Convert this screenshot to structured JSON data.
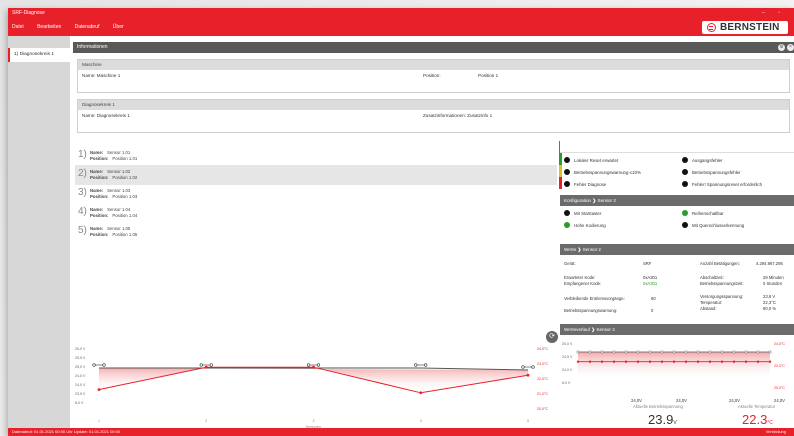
{
  "app": {
    "title": "SRF-Diagnose"
  },
  "menu": {
    "items": [
      "Datei",
      "Bearbeiten",
      "Datenabruf",
      "Über"
    ]
  },
  "logo": {
    "text": "BERNSTEIN"
  },
  "sidebar": {
    "items": [
      {
        "label": "1) Diagnosekreis 1"
      }
    ]
  },
  "info": {
    "header": "Informationen",
    "maschine": {
      "title": "Maschine",
      "name": "Name: Maschine 1",
      "position_label": "Position:",
      "position_value": "Position 1"
    },
    "diagnosekreis": {
      "title": "Diagnosekreis 1",
      "name": "Name: Diagnosekreis 1",
      "zusatz": "Zusatzinformationen: Zusatzinfo 1"
    }
  },
  "sensors": [
    {
      "num": "1)",
      "name_label": "Name:",
      "name": "Sensor 1.01",
      "pos_label": "Position:",
      "position": "Position 1.01"
    },
    {
      "num": "2)",
      "name_label": "Name:",
      "name": "Sensor 1.02",
      "pos_label": "Position:",
      "position": "Position 1.02"
    },
    {
      "num": "3)",
      "name_label": "Name:",
      "name": "Sensor 1.03",
      "pos_label": "Position:",
      "position": "Position 1.03"
    },
    {
      "num": "4)",
      "name_label": "Name:",
      "name": "Sensor 1.04",
      "pos_label": "Position:",
      "position": "Position 1.04"
    },
    {
      "num": "5)",
      "name_label": "Name:",
      "name": "Sensor 1.05",
      "pos_label": "Position:",
      "position": "Position 1.05"
    }
  ],
  "status": {
    "rows": [
      [
        "Lokaler Reset erwartet",
        "Ausgangsfehler"
      ],
      [
        "Betriebsspannungswarnung ≤10%",
        "Betriebsspannungsfehler"
      ],
      [
        "Fehler Diagnose",
        "Fehler! Spannungsreset erforderlich"
      ]
    ]
  },
  "konfig": {
    "header": "Konfiguration",
    "sub": "Sensor 2",
    "items": [
      [
        "Mit Starttaster",
        "Reihenschaltbar"
      ],
      [
        "Hohe Kodierung",
        "Mit Querschlusserkennung"
      ]
    ]
  },
  "werte": {
    "header": "Werte",
    "sub": "Sensor 2",
    "geraet_label": "Gerät:",
    "geraet": "SRF",
    "betaet_label": "Anzahl Betätigungen:",
    "betaet": "4.294.967.295",
    "erw_kode_label": "Erwarteter Kode:",
    "erw_kode": "0xA301",
    "emp_kode_label": "Empfangener Kode:",
    "emp_kode": "0xA301",
    "abschalt_label": "Abschaltzeit:",
    "abschalt": "28 Minuten",
    "betrieb_label": "Betriebsspannungszeit:",
    "betrieb": "0 Stunden",
    "verb_label": "Verbleibende Entriemsvorgänge:",
    "verb": "60",
    "vers_label": "Versorgungsspannung:",
    "vers": "23,9 V",
    "temp_label": "Temperatur:",
    "temp": "22,3°C",
    "abstand_label": "Abstand:",
    "abstand": "80,0 %",
    "bsw_label": "Betriebsspannungswarnung:",
    "bsw": "0"
  },
  "verlauf": {
    "header": "Werteverlauf",
    "sub": "Sensor 2"
  },
  "gauges": {
    "volt": {
      "label": "Aktuelle Betriebsspannung",
      "value": "23.9",
      "unit": "V",
      "min": "24,0V",
      "max": "24,0V"
    },
    "temp": {
      "label": "Aktuelle Temperatur",
      "value": "22.3",
      "unit": "°C",
      "min": "24,0V",
      "max": "24,0V"
    }
  },
  "chart_data": [
    {
      "type": "line",
      "x": [
        1,
        2,
        3,
        4,
        5
      ],
      "xlabel": "Sensoren",
      "series": [
        {
          "axis": "left",
          "values": [
            24.0,
            24.0,
            24.0,
            24.0,
            23.9
          ],
          "color": "#555555"
        },
        {
          "axis": "right",
          "values": [
            21.4,
            22.8,
            22.8,
            21.2,
            22.3
          ],
          "color": "#e8202a"
        }
      ],
      "left_ticks": [
        "26,0 V",
        "25,5 V",
        "25,0 V",
        "24,5 V",
        "24,0 V",
        "23,5 V",
        "8,0 V"
      ],
      "right_ticks": [
        "24,0°C",
        "23,0°C",
        "22,0°C",
        "21,0°C",
        "20,0°C"
      ]
    },
    {
      "type": "line",
      "series": [
        {
          "axis": "left",
          "values": [
            24.0,
            24.0,
            24.0,
            24.0,
            24.0,
            24.0,
            24.0,
            24.0,
            24.0,
            24.0,
            24.0,
            24.0,
            24.0,
            24.0,
            24.0,
            24.0,
            24.0
          ],
          "color": "#555555"
        },
        {
          "axis": "right",
          "values": [
            22.3,
            22.3,
            22.3,
            22.3,
            22.3,
            22.3,
            22.3,
            22.3,
            22.3,
            22.3,
            22.3,
            22.3,
            22.3,
            22.3,
            22.3,
            22.3,
            22.3
          ],
          "color": "#e8202a"
        }
      ],
      "left_ticks": [
        "25,0 V",
        "24,5 V",
        "24,0 V",
        "8,0 V"
      ],
      "right_ticks": [
        "24,0°C",
        "22,0°C",
        "20,0°C"
      ]
    }
  ],
  "statusbar": {
    "left": "Datenabruf: 01.01.2021 00:00 Uhr   Update: 01.01.2021 00:00",
    "right": "Verbindung"
  }
}
